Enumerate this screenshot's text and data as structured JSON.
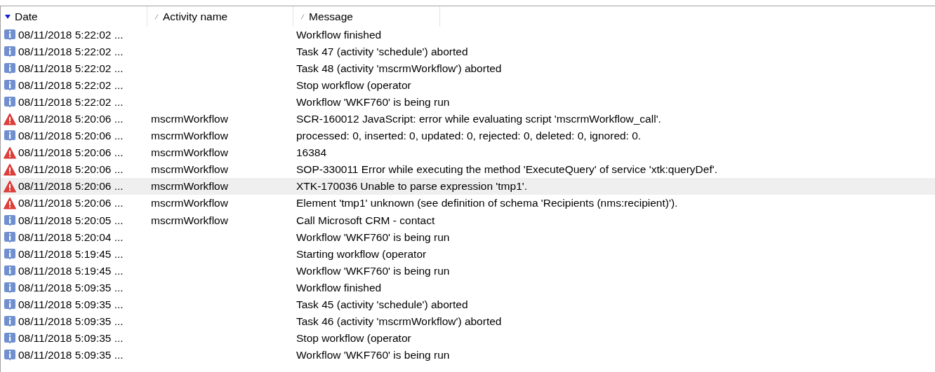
{
  "columns": [
    {
      "label": "Date",
      "sorted": true
    },
    {
      "label": "Activity name",
      "sorted": false
    },
    {
      "label": "Message",
      "sorted": false
    }
  ],
  "rows": [
    {
      "kind": "info",
      "date": "08/11/2018 5:22:02 ...",
      "activity": "",
      "message": "Workflow finished",
      "selected": false
    },
    {
      "kind": "info",
      "date": "08/11/2018 5:22:02 ...",
      "activity": "",
      "message": "Task 47 (activity 'schedule') aborted",
      "selected": false
    },
    {
      "kind": "info",
      "date": "08/11/2018 5:22:02 ...",
      "activity": "",
      "message": "Task 48 (activity 'mscrmWorkflow') aborted",
      "selected": false
    },
    {
      "kind": "info",
      "date": "08/11/2018 5:22:02 ...",
      "activity": "",
      "message": "Stop workflow (operator",
      "selected": false
    },
    {
      "kind": "info",
      "date": "08/11/2018 5:22:02 ...",
      "activity": "",
      "message": "Workflow 'WKF760' is being run",
      "selected": false
    },
    {
      "kind": "warning",
      "date": "08/11/2018 5:20:06 ...",
      "activity": "mscrmWorkflow",
      "message": "SCR-160012 JavaScript: error while evaluating script 'mscrmWorkflow_call'.",
      "selected": false
    },
    {
      "kind": "info",
      "date": "08/11/2018 5:20:06 ...",
      "activity": "mscrmWorkflow",
      "message": "processed: 0, inserted: 0, updated: 0, rejected: 0, deleted: 0, ignored: 0.",
      "selected": false
    },
    {
      "kind": "warning",
      "date": "08/11/2018 5:20:06 ...",
      "activity": "mscrmWorkflow",
      "message": "16384",
      "selected": false
    },
    {
      "kind": "warning",
      "date": "08/11/2018 5:20:06 ...",
      "activity": "mscrmWorkflow",
      "message": "SOP-330011 Error while executing the method 'ExecuteQuery' of service 'xtk:queryDef'.",
      "selected": false
    },
    {
      "kind": "warning",
      "date": "08/11/2018 5:20:06 ...",
      "activity": "mscrmWorkflow",
      "message": "XTK-170036 Unable to parse expression 'tmp1'.",
      "selected": true
    },
    {
      "kind": "warning",
      "date": "08/11/2018 5:20:06 ...",
      "activity": "mscrmWorkflow",
      "message": "Element 'tmp1' unknown (see definition of schema 'Recipients (nms:recipient)').",
      "selected": false
    },
    {
      "kind": "info",
      "date": "08/11/2018 5:20:05 ...",
      "activity": "mscrmWorkflow",
      "message": "Call Microsoft CRM - contact",
      "selected": false
    },
    {
      "kind": "info",
      "date": "08/11/2018 5:20:04 ...",
      "activity": "",
      "message": "Workflow 'WKF760' is being run",
      "selected": false
    },
    {
      "kind": "info",
      "date": "08/11/2018 5:19:45 ...",
      "activity": "",
      "message": "Starting workflow (operator",
      "selected": false
    },
    {
      "kind": "info",
      "date": "08/11/2018 5:19:45 ...",
      "activity": "",
      "message": "Workflow 'WKF760' is being run",
      "selected": false
    },
    {
      "kind": "info",
      "date": "08/11/2018 5:09:35 ...",
      "activity": "",
      "message": "Workflow finished",
      "selected": false
    },
    {
      "kind": "info",
      "date": "08/11/2018 5:09:35 ...",
      "activity": "",
      "message": "Task 45 (activity 'schedule') aborted",
      "selected": false
    },
    {
      "kind": "info",
      "date": "08/11/2018 5:09:35 ...",
      "activity": "",
      "message": "Task 46 (activity 'mscrmWorkflow') aborted",
      "selected": false
    },
    {
      "kind": "info",
      "date": "08/11/2018 5:09:35 ...",
      "activity": "",
      "message": "Stop workflow (operator",
      "selected": false
    },
    {
      "kind": "info",
      "date": "08/11/2018 5:09:35 ...",
      "activity": "",
      "message": "Workflow 'WKF760' is being run",
      "selected": false
    }
  ]
}
